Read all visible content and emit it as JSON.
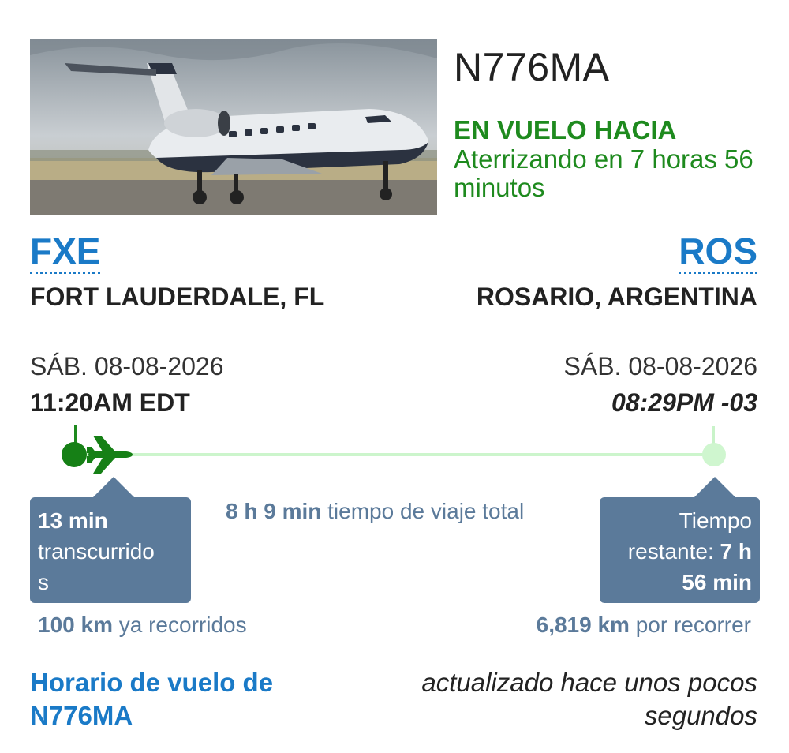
{
  "flight": {
    "tail_number": "N776MA",
    "status": "EN VUELO HACIA",
    "eta_text": "Aterrizando en 7 horas 56 minutos",
    "photo_icon": "aircraft-photo"
  },
  "origin": {
    "code": "FXE",
    "city": "FORT LAUDERDALE, FL",
    "date": "SÁB. 08-08-2026",
    "time": "11:20AM EDT"
  },
  "destination": {
    "code": "ROS",
    "city": "ROSARIO, ARGENTINA",
    "date": "SÁB. 08-08-2026",
    "time": "08:29PM -03"
  },
  "progress": {
    "elapsed_value": "13 min",
    "elapsed_label": "transcurrido",
    "elapsed_suffix": "s",
    "total_value": "8 h 9 min",
    "total_label": "tiempo de viaje total",
    "remaining_label_1": "Tiempo",
    "remaining_label_2": "restante:",
    "remaining_value_1": "7 h",
    "remaining_value_2": "56 min",
    "distance_done_value": "100 km",
    "distance_done_label": "ya recorridos",
    "distance_left_value": "6,819 km",
    "distance_left_label": "por recorrer",
    "fraction_complete": 0.027
  },
  "footer": {
    "schedule_link": "Horario de vuelo de N776MA",
    "updated_text": "actualizado hace unos pocos segundos"
  },
  "colors": {
    "green": "#1e8a1e",
    "blue": "#1a7ac7",
    "slate": "#5b7a9a"
  }
}
